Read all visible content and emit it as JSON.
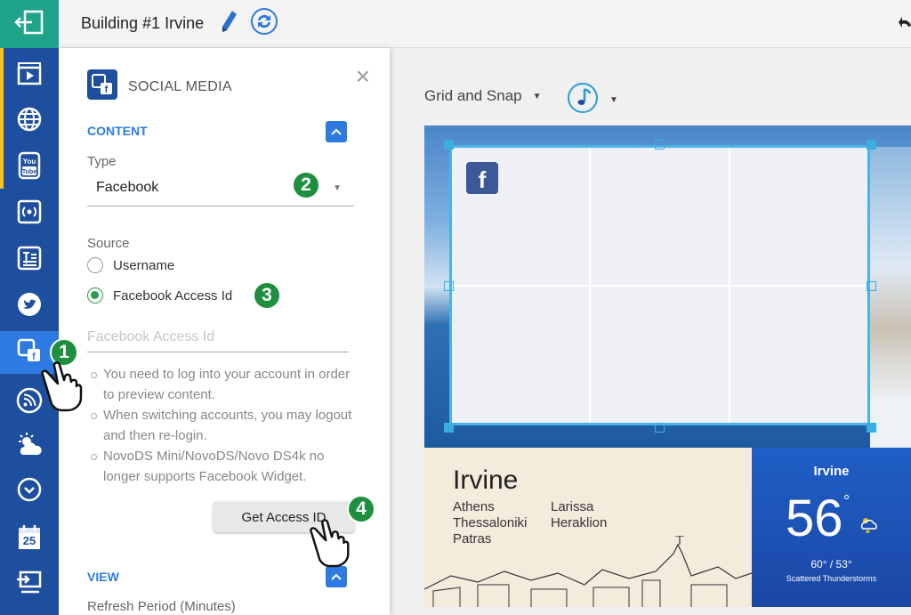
{
  "topbar": {
    "title": "Building #1 Irvine"
  },
  "rail": {
    "items": [
      {
        "icon": "exit-icon"
      },
      {
        "icon": "video-icon"
      },
      {
        "icon": "globe-icon"
      },
      {
        "icon": "youtube-icon"
      },
      {
        "icon": "stream-icon"
      },
      {
        "icon": "text-icon"
      },
      {
        "icon": "twitter-icon"
      },
      {
        "icon": "social-media-icon"
      },
      {
        "icon": "rss-icon"
      },
      {
        "icon": "weather-icon"
      },
      {
        "icon": "clock-icon"
      },
      {
        "icon": "calendar-icon"
      },
      {
        "icon": "input-icon"
      }
    ],
    "calendar_day": "25"
  },
  "panel": {
    "title": "SOCIAL MEDIA",
    "content_section": "CONTENT",
    "type_label": "Type",
    "type_value": "Facebook",
    "source_label": "Source",
    "radio_username": "Username",
    "radio_access_id": "Facebook Access Id",
    "access_id_placeholder": "Facebook Access Id",
    "notes": [
      "You need to log into your account in order to preview content.",
      "When switching accounts, you may logout and then re-login.",
      "NovoDS Mini/NovoDS/Novo DS4k no longer supports Facebook Widget."
    ],
    "get_access_button": "Get Access ID",
    "view_section": "VIEW",
    "refresh_label": "Refresh Period (Minutes)"
  },
  "badges": [
    "1",
    "2",
    "3",
    "4"
  ],
  "editor": {
    "grid_snap": "Grid and Snap",
    "cities": {
      "main": "Irvine",
      "col1": [
        "Athens",
        "Thessaloniki",
        "Patras"
      ],
      "col2": [
        "Larissa",
        "Heraklion"
      ]
    },
    "weather": {
      "city": "Irvine",
      "temp": "56",
      "degree": "°",
      "range": "60° / 53°",
      "desc": "Scattered Thunderstorms"
    }
  },
  "colors": {
    "rail": "#1e4f9e",
    "rail_top": "#1fa38a",
    "accent": "#2d7be0",
    "badge": "#1e8f3e",
    "facebook": "#3b5998"
  }
}
